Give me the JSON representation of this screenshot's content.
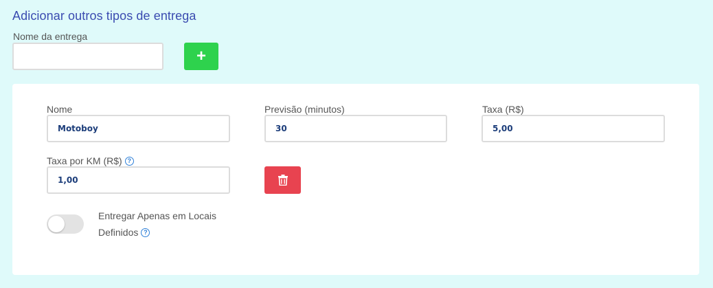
{
  "section": {
    "title": "Adicionar outros tipos de entrega"
  },
  "new_delivery": {
    "label": "Nome da entrega",
    "value": "",
    "add_label": "+"
  },
  "delivery": {
    "name_label": "Nome",
    "name_value": "Motoboy",
    "forecast_label": "Previsão (minutos)",
    "forecast_value": "30",
    "fee_label": "Taxa (R$)",
    "fee_value": "5,00",
    "fee_km_label": "Taxa por KM (R$)",
    "fee_km_value": "1,00",
    "help_glyph": "?",
    "toggle_label_line1": "Entregar Apenas em Locais",
    "toggle_label_line2": "Definidos",
    "toggle_on": false
  },
  "colors": {
    "accent_title": "#3a4bb0",
    "add_button": "#2ed24d",
    "delete_button": "#e84350",
    "help_icon": "#2d7fd8",
    "value_text": "#1c3d7a",
    "background": "#dffafa"
  },
  "icons": {
    "add": "plus-icon",
    "delete": "trash-icon",
    "help": "question-circle-icon"
  }
}
